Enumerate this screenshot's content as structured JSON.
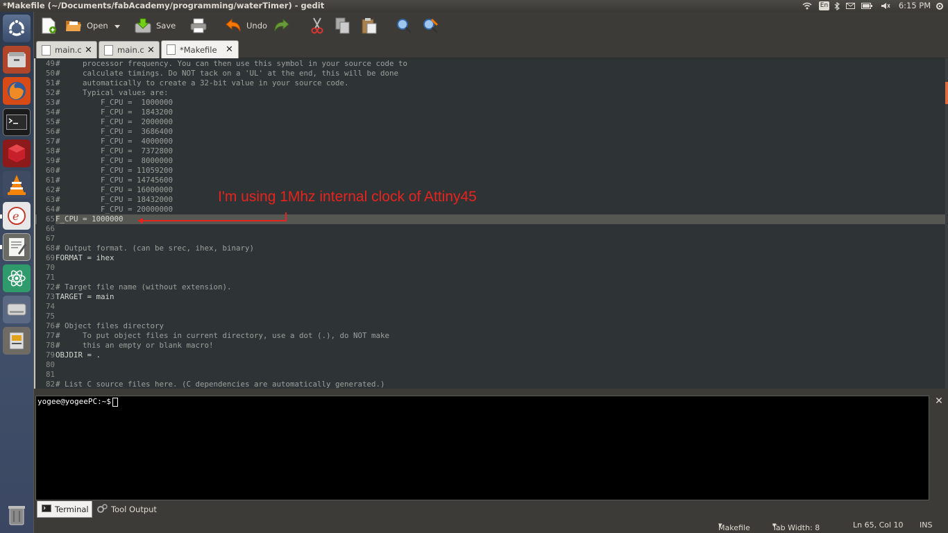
{
  "window": {
    "title": "*Makefile (~/Documents/fabAcademy/programming/waterTimer) - gedit"
  },
  "indicators": {
    "keyboard": "En",
    "clock": "6:15 PM"
  },
  "toolbar": {
    "open_label": "Open",
    "save_label": "Save",
    "undo_label": "Undo"
  },
  "tabs": [
    {
      "label": "main.c"
    },
    {
      "label": "main.c"
    },
    {
      "label": "*Makefile"
    }
  ],
  "editor": {
    "lines": [
      {
        "n": "49",
        "t": "#     processor frequency. You can then use this symbol in your source code to"
      },
      {
        "n": "50",
        "t": "#     calculate timings. Do NOT tack on a 'UL' at the end, this will be done"
      },
      {
        "n": "51",
        "t": "#     automatically to create a 32-bit value in your source code."
      },
      {
        "n": "52",
        "t": "#     Typical values are:"
      },
      {
        "n": "53",
        "t": "#         F_CPU =  1000000"
      },
      {
        "n": "54",
        "t": "#         F_CPU =  1843200"
      },
      {
        "n": "55",
        "t": "#         F_CPU =  2000000"
      },
      {
        "n": "56",
        "t": "#         F_CPU =  3686400"
      },
      {
        "n": "57",
        "t": "#         F_CPU =  4000000"
      },
      {
        "n": "58",
        "t": "#         F_CPU =  7372800"
      },
      {
        "n": "59",
        "t": "#         F_CPU =  8000000"
      },
      {
        "n": "60",
        "t": "#         F_CPU = 11059200"
      },
      {
        "n": "61",
        "t": "#         F_CPU = 14745600"
      },
      {
        "n": "62",
        "t": "#         F_CPU = 16000000"
      },
      {
        "n": "63",
        "t": "#         F_CPU = 18432000"
      },
      {
        "n": "64",
        "t": "#         F_CPU = 20000000"
      },
      {
        "n": "65",
        "t": "F_CPU = 1000000"
      },
      {
        "n": "66",
        "t": ""
      },
      {
        "n": "67",
        "t": ""
      },
      {
        "n": "68",
        "t": "# Output format. (can be srec, ihex, binary)"
      },
      {
        "n": "69",
        "t": "FORMAT = ihex"
      },
      {
        "n": "70",
        "t": ""
      },
      {
        "n": "71",
        "t": ""
      },
      {
        "n": "72",
        "t": "# Target file name (without extension)."
      },
      {
        "n": "73",
        "t": "TARGET = main"
      },
      {
        "n": "74",
        "t": ""
      },
      {
        "n": "75",
        "t": ""
      },
      {
        "n": "76",
        "t": "# Object files directory"
      },
      {
        "n": "77",
        "t": "#     To put object files in current directory, use a dot (.), do NOT make"
      },
      {
        "n": "78",
        "t": "#     this an empty or blank macro!"
      },
      {
        "n": "79",
        "t": "OBJDIR = ."
      },
      {
        "n": "80",
        "t": ""
      },
      {
        "n": "81",
        "t": ""
      },
      {
        "n": "82",
        "t": "# List C source files here. (C dependencies are automatically generated.)"
      }
    ],
    "annotation": "I'm using 1Mhz internal clock of Attiny45"
  },
  "terminal": {
    "prompt": "yogee@yogeePC:~$"
  },
  "bottom_tabs": {
    "terminal": "Terminal",
    "tool_output": "Tool Output"
  },
  "status": {
    "language": "Makefile",
    "tab_width": "Tab Width: 8",
    "position": "Ln 65, Col 10",
    "mode": "INS"
  }
}
